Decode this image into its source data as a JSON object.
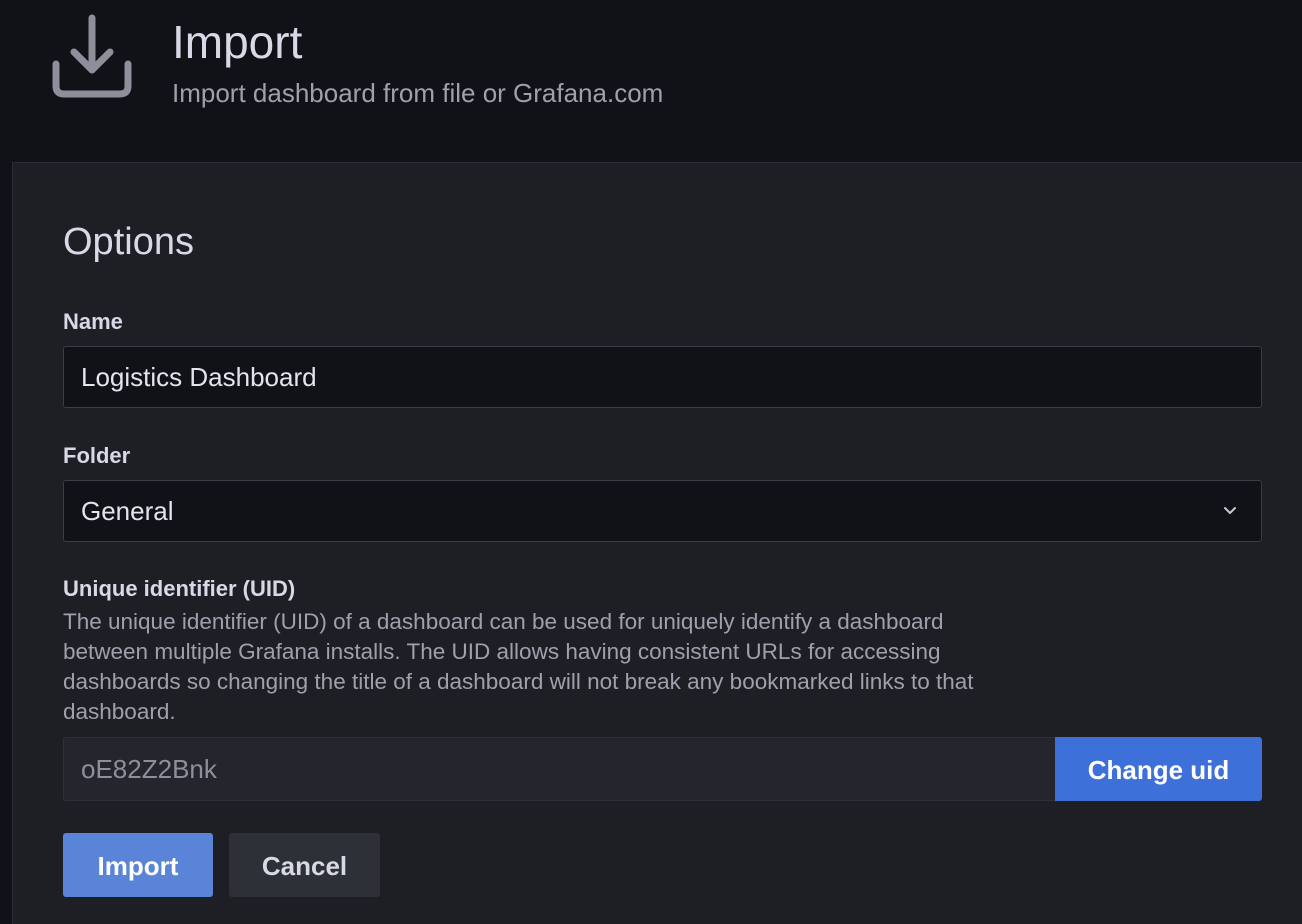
{
  "header": {
    "icon": "download-icon",
    "title": "Import",
    "subtitle": "Import dashboard from file or Grafana.com"
  },
  "options": {
    "title": "Options",
    "name": {
      "label": "Name",
      "value": "Logistics Dashboard"
    },
    "folder": {
      "label": "Folder",
      "selected": "General",
      "icon": "chevron-down-icon"
    },
    "uid": {
      "label": "Unique identifier (UID)",
      "description": "The unique identifier (UID) of a dashboard can be used for uniquely identify a dashboard between multiple Grafana installs. The UID allows having consistent URLs for accessing dashboards so changing the title of a dashboard will not break any bookmarked links to that dashboard.",
      "value": "oE82Z2Bnk",
      "change_label": "Change uid"
    }
  },
  "actions": {
    "import_label": "Import",
    "cancel_label": "Cancel"
  },
  "colors": {
    "primary": "#3d71d9",
    "background": "#111217",
    "panel": "#1e1f25"
  }
}
